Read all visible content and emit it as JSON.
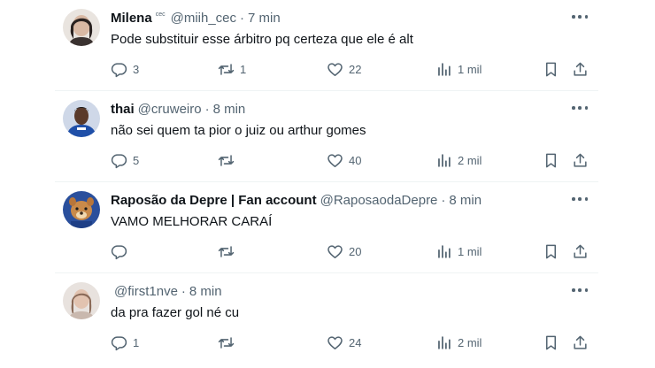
{
  "tweets": [
    {
      "name": "Milena",
      "badge": "cec",
      "handle": "@miih_cec",
      "separator": "·",
      "time": "7 min",
      "text": "Pode substituir esse árbitro pq certeza que ele é alt",
      "replies": "3",
      "retweets": "1",
      "likes": "22",
      "views": "1 mil"
    },
    {
      "name": "thai",
      "badge": "",
      "handle": "@cruweiro",
      "separator": "·",
      "time": "8 min",
      "text": "não sei quem ta pior o juiz ou arthur gomes",
      "replies": "5",
      "retweets": "",
      "likes": "40",
      "views": "2 mil"
    },
    {
      "name": "Raposão da Depre | Fan account",
      "badge": "",
      "handle": "@RaposaodaDepre",
      "separator": "·",
      "time": "8 min",
      "text": "VAMO MELHORAR CARAÍ",
      "replies": "",
      "retweets": "",
      "likes": "20",
      "views": "1 mil"
    },
    {
      "name": "",
      "badge": "",
      "handle": "@first1nve",
      "separator": "·",
      "time": "8 min",
      "text": "da pra fazer gol né cu",
      "replies": "1",
      "retweets": "",
      "likes": "24",
      "views": "2 mil"
    }
  ],
  "icons": {
    "reply": "reply-icon",
    "retweet": "retweet-icon",
    "like": "heart-icon",
    "views": "views-icon",
    "bookmark": "bookmark-icon",
    "share": "share-icon",
    "more": "more-icon"
  },
  "colors": {
    "text": "#0f1419",
    "secondary": "#536471",
    "divider": "#eff3f4"
  }
}
